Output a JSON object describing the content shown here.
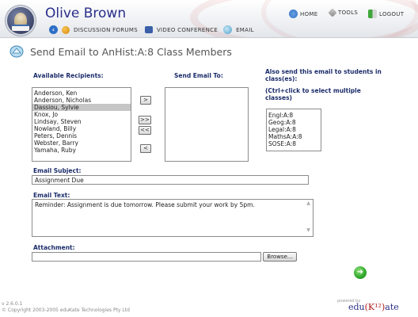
{
  "header": {
    "user_name": "Olive Brown",
    "top_links": {
      "home": "HOME",
      "tools": "TOOLS",
      "logout": "LOGOUT"
    },
    "sub_links": {
      "discussion": "DISCUSSION FORUMS",
      "video": "VIDEO CONFERENCE",
      "email": "EMAIL"
    }
  },
  "page": {
    "title": "Send Email to AnHist:A:8 Class Members"
  },
  "recipients": {
    "available_label": "Available Recipients:",
    "send_to_label": "Send Email To:",
    "available": [
      "Anderson, Ken",
      "Anderson, Nicholas",
      "Dassiou, Sylvie",
      "Knox, Jo",
      "Lindsay, Steven",
      "Nowland, Billy",
      "Peters, Dennis",
      "Webster, Barry",
      "Yamaha, Ruby"
    ],
    "selected_index": 2,
    "send_to": [],
    "buttons": {
      "add": ">",
      "add_all": ">>",
      "remove_all": "<<",
      "remove": "<"
    }
  },
  "classes": {
    "label_line1": "Also send this email to students in",
    "label_line2": "class(es):",
    "hint_line1": "(Ctrl+click to select multiple",
    "hint_line2": "classes)",
    "items": [
      "Engl:A:8",
      "Geog:A:8",
      "Legal:A:8",
      "MathsA:A:8",
      "SOSE:A:8"
    ]
  },
  "form": {
    "subject_label": "Email Subject:",
    "subject_value": "Assignment Due",
    "text_label": "Email Text:",
    "text_value": "Reminder: Assignment is due tomorrow. Please submit your work by 5pm.",
    "attachment_label": "Attachment:",
    "attachment_value": "",
    "browse_label": "Browse..."
  },
  "footer": {
    "version": "v 2.6.0.1",
    "copyright": "© Copyright 2003-2005 eduKate Technologies Pty Ltd",
    "powered_by": "powered by",
    "brand_prefix": "edu",
    "brand_k": "(K¹²)",
    "brand_suffix": "ate"
  },
  "colors": {
    "accent": "#1c2d6b",
    "title": "#2a2f8a",
    "brand_red": "#b11818",
    "go_green": "#2fa82a"
  }
}
